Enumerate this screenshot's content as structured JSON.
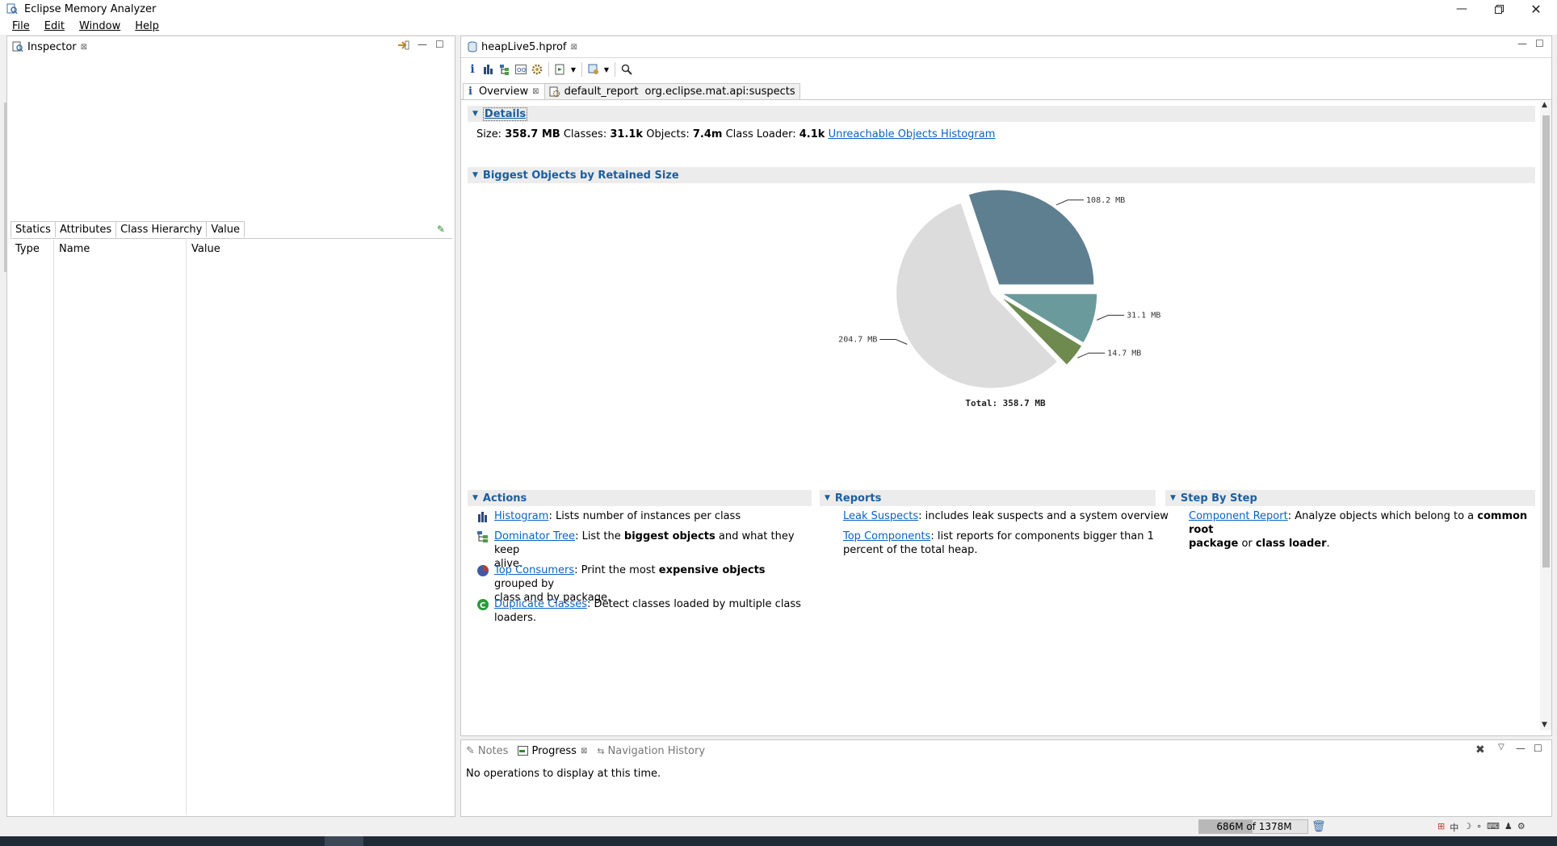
{
  "window": {
    "title": "Eclipse Memory Analyzer",
    "controls": [
      "minimize-icon",
      "restore-icon",
      "close-icon"
    ]
  },
  "menu": {
    "items": [
      "File",
      "Edit",
      "Window",
      "Help"
    ]
  },
  "inspector": {
    "tab_label": "Inspector",
    "subtabs": [
      "Statics",
      "Attributes",
      "Class Hierarchy",
      "Value"
    ],
    "columns": [
      "Type",
      "Name",
      "Value"
    ]
  },
  "editor": {
    "file_tab": "heapLive5.hprof",
    "subtabs": {
      "overview": "Overview",
      "report_name": "default_report",
      "report_id": "org.eclipse.mat.api:suspects"
    },
    "toolbar_icons": [
      "info-icon",
      "histogram-icon",
      "dominator-tree-icon",
      "oql-icon",
      "gear-icon",
      "run-report-icon",
      "dropdown-icon",
      "query-browser-icon",
      "dropdown-icon",
      "search-icon"
    ]
  },
  "details": {
    "header": "Details",
    "size_label": "Size:",
    "size_value": "358.7 MB",
    "classes_label": "Classes:",
    "classes_value": "31.1k",
    "objects_label": "Objects:",
    "objects_value": "7.4m",
    "loader_label": "Class Loader:",
    "loader_value": "4.1k",
    "link": "Unreachable Objects Histogram"
  },
  "biggest": {
    "header": "Biggest Objects by Retained Size"
  },
  "chart_data": {
    "type": "pie",
    "unit": "MB",
    "slices": [
      {
        "label": "108.2 MB",
        "value": 108.2,
        "color": "#5e7f90"
      },
      {
        "label": "31.1 MB",
        "value": 31.1,
        "color": "#6b9a9c"
      },
      {
        "label": "14.7 MB",
        "value": 14.7,
        "color": "#6e8a4f"
      },
      {
        "label": "204.7 MB",
        "value": 204.7,
        "color": "#dcdcdc"
      }
    ],
    "total_label": "Total: 358.7 MB"
  },
  "actions": {
    "header": "Actions",
    "items": [
      {
        "link": "Histogram",
        "pre": ": Lists number of instances per class",
        "bold": "",
        "post": "",
        "line2": ""
      },
      {
        "link": "Dominator Tree",
        "pre": ": List the ",
        "bold": "biggest objects",
        "post": " and what they keep",
        "line2": "alive."
      },
      {
        "link": "Top Consumers",
        "pre": ": Print the most ",
        "bold": "expensive objects",
        "post": " grouped by",
        "line2": "class and by package."
      },
      {
        "link": "Duplicate Classes",
        "pre": ": Detect classes loaded by multiple class",
        "bold": "",
        "post": "",
        "line2": "loaders."
      }
    ]
  },
  "reports": {
    "header": "Reports",
    "items": [
      {
        "link": "Leak Suspects",
        "text": ": includes leak suspects and a system overview",
        "line2": ""
      },
      {
        "link": "Top Components",
        "text": ": list reports for components bigger than 1",
        "line2": "percent of the total heap."
      }
    ]
  },
  "stepbystep": {
    "header": "Step By Step",
    "link": "Component Report",
    "text": ": Analyze objects which belong to a ",
    "bold1": "common root",
    "bold2": "package",
    "or": " or ",
    "bold3": "class loader",
    "end": "."
  },
  "bottom_panel": {
    "tabs": [
      "Notes",
      "Progress",
      "Navigation History"
    ],
    "message": "No operations to display at this time."
  },
  "status": {
    "heap": "686M of 1378M"
  },
  "colors": {
    "link": "#0b62c2",
    "section_title": "#1c5e9c",
    "section_bg": "#ececec"
  }
}
